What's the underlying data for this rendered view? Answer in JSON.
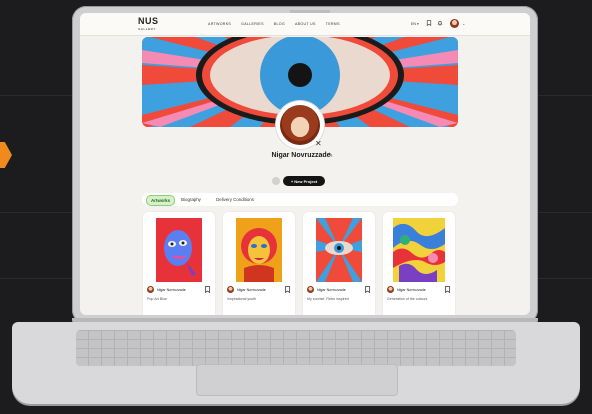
{
  "header": {
    "logo": "NUS",
    "logo_sub": "GALLERY",
    "nav": [
      "ARTWORKS",
      "GALLERIES",
      "BLOG",
      "ABOUT US",
      "TERMS"
    ],
    "lang": "EN"
  },
  "profile": {
    "name": "Nigar Novruzzade"
  },
  "actions": {
    "new_project": "+ New Project"
  },
  "tabs": [
    "Artworks",
    "Biography",
    "Delivery Conditions"
  ],
  "cards": [
    {
      "user": "Nigar Novruzzade",
      "title": "Pop Art Blue"
    },
    {
      "user": "Nigar Novruzzade",
      "title": "Inspirational youth"
    },
    {
      "user": "Nigar Novruzzade",
      "title": "My sunrise, Retro inspired"
    },
    {
      "user": "Nigar Novruzzade",
      "title": "Generation of the colours"
    }
  ],
  "colors": {
    "accent_green": "#8fcf74",
    "banner_red": "#f04a3a",
    "banner_blue": "#3fa0e0",
    "orange": "#f08a1c"
  }
}
